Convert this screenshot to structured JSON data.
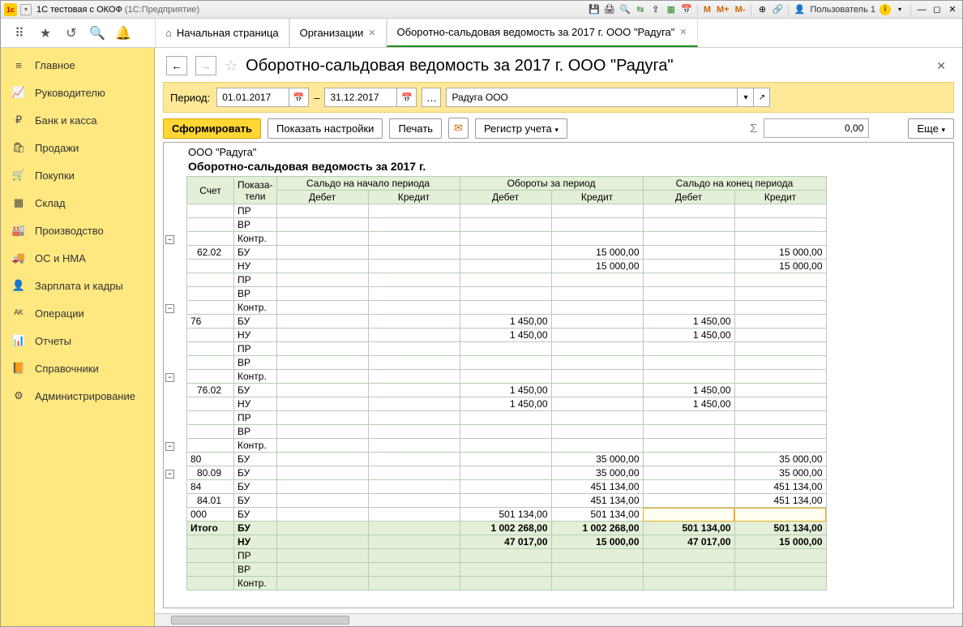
{
  "titlebar": {
    "app": "1С тестовая с ОКОФ",
    "sub": "(1С:Предприятие)",
    "user": "Пользователь 1",
    "m": "M",
    "mplus": "M+",
    "mminus": "M-"
  },
  "tabs": {
    "home": "Начальная страница",
    "org": "Организации",
    "report": "Оборотно-сальдовая ведомость за 2017 г. ООО \"Радуга\""
  },
  "sidebar": [
    {
      "icon": "≡",
      "label": "Главное"
    },
    {
      "icon": "📈",
      "label": "Руководителю"
    },
    {
      "icon": "₽",
      "label": "Банк и касса"
    },
    {
      "icon": "🛍",
      "label": "Продажи"
    },
    {
      "icon": "🛒",
      "label": "Покупки"
    },
    {
      "icon": "▦",
      "label": "Склад"
    },
    {
      "icon": "🏭",
      "label": "Производство"
    },
    {
      "icon": "🚚",
      "label": "ОС и НМА"
    },
    {
      "icon": "👤",
      "label": "Зарплата и кадры"
    },
    {
      "icon": "ᴬᴷ",
      "label": "Операции"
    },
    {
      "icon": "📊",
      "label": "Отчеты"
    },
    {
      "icon": "📙",
      "label": "Справочники"
    },
    {
      "icon": "⚙",
      "label": "Администрирование"
    }
  ],
  "page": {
    "title": "Оборотно-сальдовая ведомость за 2017 г. ООО \"Радуга\"",
    "period_label": "Период:",
    "date_from": "01.01.2017",
    "date_to": "31.12.2017",
    "dash": "–",
    "org": "Радуга ООО",
    "btn_form": "Сформировать",
    "btn_settings": "Показать настройки",
    "btn_print": "Печать",
    "btn_reg": "Регистр учета",
    "btn_more": "Еще",
    "sum": "0,00"
  },
  "report": {
    "org": "ООО \"Радуга\"",
    "title": "Оборотно-сальдовая ведомость за 2017 г.",
    "cols": {
      "acct": "Счет",
      "ind": "Показа-\nтели",
      "g1": "Сальдо на начало периода",
      "g2": "Обороты за период",
      "g3": "Сальдо на конец периода",
      "dt": "Дебет",
      "kt": "Кредит"
    },
    "indicators": [
      "БУ",
      "НУ",
      "ПР",
      "ВР",
      "Контр."
    ],
    "rows": [
      {
        "acct": "",
        "vals": {
          "ПР": {},
          "ВР": {},
          "Контр.": {}
        }
      },
      {
        "acct": "62.02",
        "vals": {
          "БУ": {
            "ob_kt": "15 000,00",
            "se_kt": "15 000,00"
          },
          "НУ": {
            "ob_kt": "15 000,00",
            "se_kt": "15 000,00"
          },
          "ПР": {},
          "ВР": {},
          "Контр.": {}
        }
      },
      {
        "acct": "76",
        "vals": {
          "БУ": {
            "ob_dt": "1 450,00",
            "se_dt": "1 450,00"
          },
          "НУ": {
            "ob_dt": "1 450,00",
            "se_dt": "1 450,00"
          },
          "ПР": {},
          "ВР": {},
          "Контр.": {}
        }
      },
      {
        "acct": "76.02",
        "vals": {
          "БУ": {
            "ob_dt": "1 450,00",
            "se_dt": "1 450,00"
          },
          "НУ": {
            "ob_dt": "1 450,00",
            "se_dt": "1 450,00"
          },
          "ПР": {},
          "ВР": {},
          "Контр.": {}
        }
      },
      {
        "acct": "80",
        "vals": {
          "БУ": {
            "ob_kt": "35 000,00",
            "se_kt": "35 000,00"
          }
        }
      },
      {
        "acct": "80.09",
        "vals": {
          "БУ": {
            "ob_kt": "35 000,00",
            "se_kt": "35 000,00"
          }
        }
      },
      {
        "acct": "84",
        "vals": {
          "БУ": {
            "ob_kt": "451 134,00",
            "se_kt": "451 134,00"
          }
        }
      },
      {
        "acct": "84.01",
        "vals": {
          "БУ": {
            "ob_kt": "451 134,00",
            "se_kt": "451 134,00"
          }
        }
      },
      {
        "acct": "000",
        "hl": true,
        "vals": {
          "БУ": {
            "ob_dt": "501 134,00",
            "ob_kt": "501 134,00"
          }
        }
      }
    ],
    "total_label": "Итого",
    "totals": {
      "БУ": {
        "ob_dt": "1 002 268,00",
        "ob_kt": "1 002 268,00",
        "se_dt": "501 134,00",
        "se_kt": "501 134,00"
      },
      "НУ": {
        "ob_dt": "47 017,00",
        "ob_kt": "15 000,00",
        "se_dt": "47 017,00",
        "se_kt": "15 000,00"
      },
      "ПР": {},
      "ВР": {},
      "Контр.": {}
    }
  }
}
